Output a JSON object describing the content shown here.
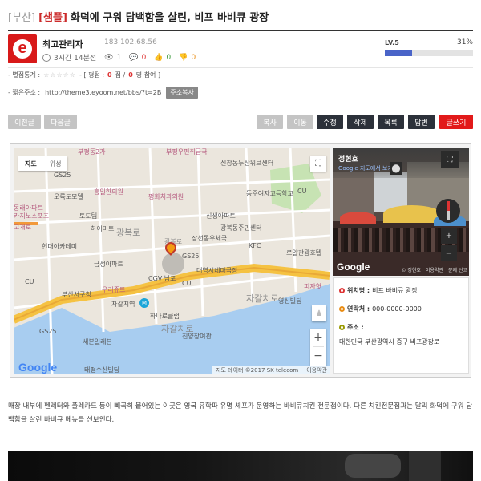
{
  "post": {
    "region": "[부산]",
    "tag": "[샘플]",
    "title": "화덕에 구워 담백함을 살린, 비프 바비큐 광장"
  },
  "author": {
    "logo_letter": "e",
    "name": "최고관리자",
    "ip": "183.102.68.56",
    "time_ago": "3시간 14분전",
    "views": "1",
    "comments": "0",
    "likes": "0",
    "dislikes": "0",
    "level_label": "LV.5",
    "level_percent_text": "31%",
    "level_progress": 0.31
  },
  "rating": {
    "label": "- 별점통계 :",
    "stars": "☆☆☆☆☆",
    "bracket_start": "- [ 평점 :",
    "score": "0",
    "middle": "점 /",
    "count": "0",
    "bracket_end": "명 참여 ]"
  },
  "short_url": {
    "label": "- 짧은주소 :",
    "url": "http://theme3.eyoom.net/bbs/?t=2B",
    "copy_button": "주소복사"
  },
  "nav_buttons": {
    "prev": "이전글",
    "next": "다음글"
  },
  "action_buttons": {
    "copy": "복사",
    "move": "이동",
    "edit": "수정",
    "delete": "삭제",
    "list": "목록",
    "reply": "답변",
    "write": "글쓰기"
  },
  "map": {
    "tab_map": "지도",
    "tab_satellite": "위성",
    "google_logo": "Google",
    "footer_data": "지도 데이터 ©2017 SK telecom",
    "footer_terms": "이용약관",
    "labels": [
      "부평동2가",
      "부평우편취급국",
      "신창동두산위브센터",
      "오륙도모텔",
      "홍일한의원",
      "평화치과의원",
      "동주여자고등학교",
      "광복로",
      "토도템",
      "하이마트",
      "광복로",
      "신생아파트",
      "광복동주민센터",
      "장선동우체국",
      "KFC",
      "로얄관광호텔",
      "현대아카데미",
      "금성아파트",
      "대영시네마극장",
      "CGV 남포",
      "부산서구청",
      "자갈치역",
      "하나로클럽",
      "진양장여관",
      "세븐일레븐",
      "태평수산빌딩",
      "영신빌딩",
      "자갈치로",
      "자갈치로",
      "우리쥬트",
      "GS25",
      "GS25",
      "GS25",
      "CU",
      "CU",
      "CU",
      "고개로",
      "동래아파트",
      "카지노스포츠",
      "피자헛"
    ]
  },
  "street_view": {
    "title": "정현호",
    "subtitle": "Google 지도에서 보기",
    "google_logo": "Google",
    "footer_credit": "© 정현호",
    "footer_terms": "이용약관",
    "footer_report": "문제 신고"
  },
  "place_info": {
    "name_label": "위치명 :",
    "name_value": "비프 바비큐 광장",
    "phone_label": "연락처 :",
    "phone_value": "000-0000-0000",
    "address_label": "주소 :",
    "address_value": "대한민국 부산광역시 중구 비프광장로"
  },
  "body_text": "매장 내부에 펜레터와 폴레카드 등이 빼곡히 붙어있는 이곳은 영국 유학파 유명 셰프가 운영하는 바비큐치킨 전문점이다. 다른 치킨전문점과는 달리 화덕에 구워 담백함을 살린 바비큐 메뉴를 선보인다.",
  "colors": {
    "brand_red": "#d81919",
    "dark_button": "#2c313a",
    "write_button": "#e21a1a",
    "level_bar": "#4a64c8",
    "tag_red": "#cc2b2b"
  }
}
